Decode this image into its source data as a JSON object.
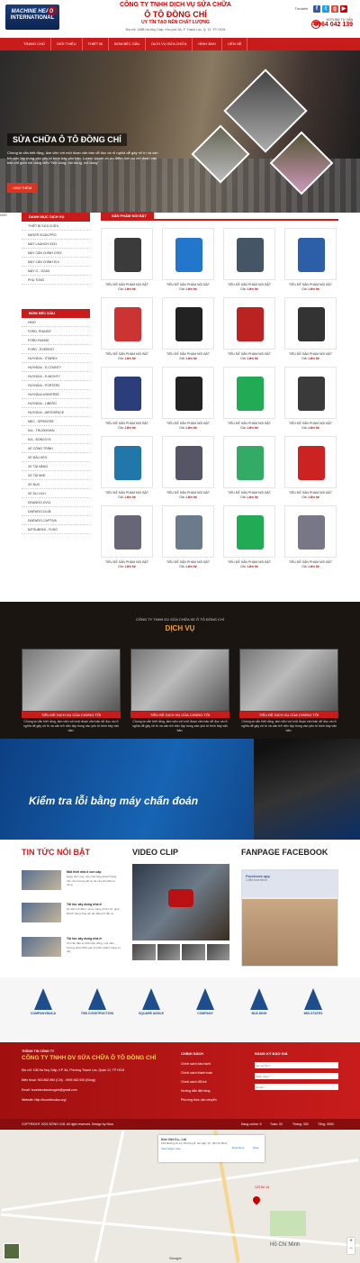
{
  "header": {
    "logo_line1": "MACHINE HEAD",
    "logo_line2": "INTERNATIONAL",
    "company_line1": "CÔNG TY TNHH DỊCH VỤ SỬA CHỮA",
    "company_line2": "Ô TÔ ĐỒNG CHÍ",
    "slogan": "UY TÍN TẠO NÊN CHẤT LƯỢNG",
    "address": "Địa chỉ: 108B Hà Huy Giáp, Khu phố 3A, P. Thạnh Lộc, Q. 12, TP. HCM",
    "search_label": "Tìm kiếm",
    "hotline_label": "HOTLINE TƯ VẤN",
    "hotline_number": "0964 042 139"
  },
  "nav": [
    "TRANG CHỦ",
    "GIỚI THIỆU",
    "THIẾT BỊ",
    "BƠM BÉC DẦU",
    "DỊCH VỤ SỬA CHỮA",
    "HÌNH ẢNH",
    "LIÊN HỆ"
  ],
  "hero": {
    "title": "SỬA CHỮA Ô TÔ ĐỒNG CHÍ",
    "description": "Chúng ta vẫn biết rằng, làm việc với một đoạn văn bản dễ đọc và rõ nghĩa dễ gây rối trí và cản trở việc tập trung vào yếu tố trình bày văn bản. Lorem Ipsum có ưu điểm hơn so với đoạn văn bản chỉ gồm nội dung kiểu \"Nội dung, nội dung, nội dung\"",
    "button": "XEM THÊM"
  },
  "sidebar": {
    "services_title": "DANH MỤC DỊCH VỤ",
    "services": [
      "THIẾT BỊ SỬA CHỮA",
      "MAYER SCAN PRO",
      "MÁY LAUNCH X431",
      "MÁY CÂN CHỈNH CRDI",
      "MÁY CÂN CHỈNH EUI",
      "MÁY G - SCAN",
      "PHỤ TÙNG"
    ],
    "pumps_title": "BƠM BÉC DẦU",
    "pumps": [
      "HINO",
      "FORD-TRANSIT",
      "FORD-RANGE",
      "FORD - EVEREST",
      "HUYNDAI - STAREX",
      "HUYNDAI - E-COUNTY",
      "HUYNDAI - E-MIGHTY",
      "HUYNDAI - PORTER2",
      "HUYNDAI-UNIVERSE",
      "HUYNDAI - LIBERO",
      "HUYNDAI - AEROSPACE",
      "MEC - SPRINTER",
      "KIA - TRUONGHAI",
      "KIA - BONGO III",
      "XE CÔNG TRÌNH",
      "XE ĐẦU KÉO",
      "XE TẢI NẶNG",
      "XE TẢI NHẸ",
      "XE BUS",
      "XE DU LỊCH",
      "DEAWOO-DV11",
      "DAEWOO-DL08",
      "DAEWOO-CAPTIVA",
      "MITSUBISHI - FUSO"
    ]
  },
  "products": {
    "title": "SẢN PHẨM NỔI BẬT",
    "item_name": "TIÊU ĐỀ SẢN PHẨM NỔI BẬT",
    "price_label": "Giá:",
    "price_value": "Liên hệ",
    "colors": [
      "#3b3b3b",
      "#2277cc",
      "#445566",
      "#2d5fa8",
      "#c33",
      "#222",
      "#b22",
      "#333",
      "#2c3e7a",
      "#222",
      "#2a5",
      "#3a3a3a",
      "#27a",
      "#556",
      "#3a6",
      "#c22",
      "#667",
      "#6b7b8b",
      "#2a5",
      "#778"
    ]
  },
  "services": {
    "company": "CÔNG TY TNHH DV SỬA CHỮA XE Ô TÔ ĐỒNG CHÍ",
    "title": "DỊCH VỤ",
    "item_title": "TIÊU ĐỀ DỊCH VỤ CỦA CHÚNG TÔI",
    "item_desc": "Chúng ta vẫn biết rằng, làm việc với một đoạn văn bản dễ đọc và rõ nghĩa dễ gây rối trí và cản trở việc tập trung vào yếu tố trình bày văn bản."
  },
  "banner": {
    "text": "Kiểm tra lỗi bằng máy chẩn đoán"
  },
  "news": {
    "title": "TIN TỨC NỔI BẬT",
    "items": [
      {
        "title": "Một thời nhà ổ con cấp",
        "desc": "Ngày hôm nay, các cửa hàng khách hàng các chủ trương tiết sự lái của chủ đầu tư công"
      },
      {
        "title": "Tôi tốc xây dựng nhà ở",
        "desc": "Dự kiến số điểm, sẽ ra mạng 12/12 tới, giúp khách hàng thao tác dễ dàng khi lắp xe..."
      },
      {
        "title": "Tôi tốc xây dựng nhà ở",
        "desc": "Chỉ cần đầu tư 200 triệu đồng, mỗi năm, hướng đoàn 50% giá trị tỉ đối, khách hàng có thể"
      }
    ]
  },
  "video": {
    "title": "VIDEO CLIP"
  },
  "facebook": {
    "title": "FANPAGE FACEBOOK",
    "page_name": "Facebook app",
    "likes": "1.5M lượt thích"
  },
  "partners": [
    "COMPANYBUILD",
    "TSB CONSTRUCTION",
    "SQUARE ANGLE",
    "COMPANY",
    "BUILDING",
    "MID-STATES"
  ],
  "footer": {
    "info_title": "THÔNG TIN CÔNG TY",
    "company": "CÔNG TY TNHH DV SỬA CHỮA Ô TÔ ĐỒNG CHÍ",
    "address": "Địa chỉ: 108 Hà Huy Giáp, KP 3A, Phường Thạnh Lộc, Quận 12, TP HCM",
    "phone": "Điện thoại: 903 862 890 (Chị) - 0909 462 920 (Đồng)",
    "email": "Email: buonbecdaudongchi@gmail.com",
    "website": "Website: http://buonbecdau.org/",
    "policy_title": "CHÍNH SÁCH",
    "policies": [
      "Chính sách bảo hành",
      "Chính sách thanh toán",
      "Chính sách đổi trả",
      "Hướng dẫn đặt hàng",
      "Phương thức vận chuyển"
    ],
    "subscribe_title": "ĐĂNG KÝ BÁO GIÁ",
    "name_placeholder": "Họ và Tên *",
    "phone_placeholder": "Điện thoại *",
    "email_placeholder": "Email *",
    "submit": "GỬI"
  },
  "bottom_bar": {
    "copyright": "COPYRIGHT 2021 ĐỒNG CHÍ. All right reserved. Design by Nina",
    "online": "Đang online: 5",
    "week": "Tuần: 30",
    "month": "Tháng: 300",
    "total": "Tổng: 3000"
  },
  "map": {
    "place_name": "Kim Viet Co., Ltd",
    "place_address": "123 đường số 14, Phường 8, Gò Vấp, Tp. Hồ Chí Minh",
    "directions": "Directions",
    "save": "Save",
    "view_larger": "View larger map",
    "pin_label": "123 Số 14",
    "city": "Hồ Chí Minh",
    "google": "Google"
  }
}
